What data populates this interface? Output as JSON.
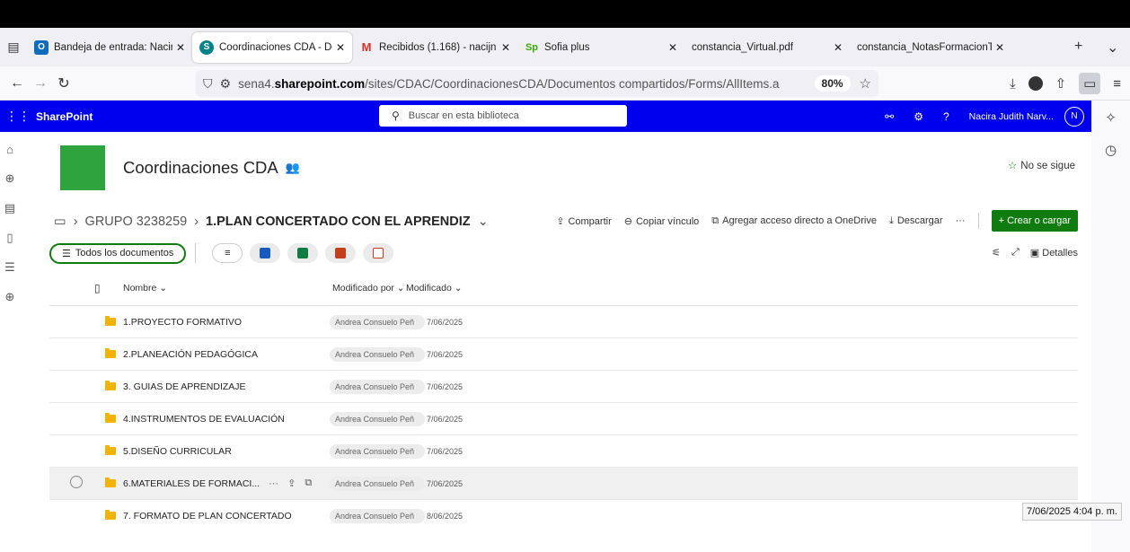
{
  "browser": {
    "tabs": [
      {
        "title": "Bandeja de entrada: Nacir",
        "favicon": "outlook-icon",
        "color": "#0f6cbd"
      },
      {
        "title": "Coordinaciones CDA - Do",
        "favicon": "sharepoint-icon",
        "color": "#038387",
        "active": true
      },
      {
        "title": "Recibidos (1.168) - nacijn",
        "favicon": "gmail-icon",
        "color": "#d93025"
      },
      {
        "title": "Sofia plus",
        "favicon": "sofia-icon",
        "color": "#39a900"
      },
      {
        "title": "constancia_Virtual.pdf",
        "favicon": "pdf-icon",
        "color": "#666666"
      },
      {
        "title": "constancia_NotasFormacionT",
        "favicon": "pdf-icon",
        "color": "#666666"
      }
    ],
    "url_prefix": "sena4.",
    "url_host": "sharepoint.com",
    "url_path": "/sites/CDAC/CoordinacionesCDA/Documentos compartidos/Forms/AllItems.a",
    "zoom": "80%"
  },
  "suite": {
    "brand": "SharePoint",
    "search_placeholder": "Buscar en esta biblioteca",
    "user_name": "Nacira Judith Narv...",
    "user_initial": "N"
  },
  "site": {
    "title": "Coordinaciones CDA",
    "follow_label": "No se sigue"
  },
  "breadcrumb": {
    "parent": "GRUPO 3238259",
    "current": "1.PLAN CONCERTADO CON EL APRENDIZ"
  },
  "commands": {
    "share": "Compartir",
    "copy_link": "Copiar vínculo",
    "add_shortcut": "Agregar acceso directo a OneDrive",
    "download": "Descargar",
    "new": "+ Crear o cargar"
  },
  "view": {
    "name": "Todos los documentos",
    "details": "Detalles"
  },
  "columns": {
    "name": "Nombre",
    "modified_by": "Modificado por",
    "modified": "Modificado"
  },
  "rows": [
    {
      "name": "1.PROYECTO FORMATIVO",
      "by": "Andrea Consuelo Peñ",
      "date": "7/06/2025"
    },
    {
      "name": "2.PLANEACIÓN PEDAGÓGICA",
      "by": "Andrea Consuelo Peñ",
      "date": "7/06/2025"
    },
    {
      "name": "3. GUIAS DE APRENDIZAJE",
      "by": "Andrea Consuelo Peñ",
      "date": "7/06/2025"
    },
    {
      "name": "4.INSTRUMENTOS DE EVALUACIÓN",
      "by": "Andrea Consuelo Peñ",
      "date": "7/06/2025"
    },
    {
      "name": "5.DISEÑO CURRICULAR",
      "by": "Andrea Consuelo Peñ",
      "date": "7/06/2025"
    },
    {
      "name": "6.MATERIALES DE FORMACI...",
      "by": "Andrea Consuelo Peñ",
      "date": "7/06/2025"
    },
    {
      "name": "7. FORMATO DE PLAN CONCERTADO",
      "by": "Andrea Consuelo Peñ",
      "date": "8/06/2025"
    }
  ],
  "tooltip": "7/06/2025 4:04 p. m."
}
